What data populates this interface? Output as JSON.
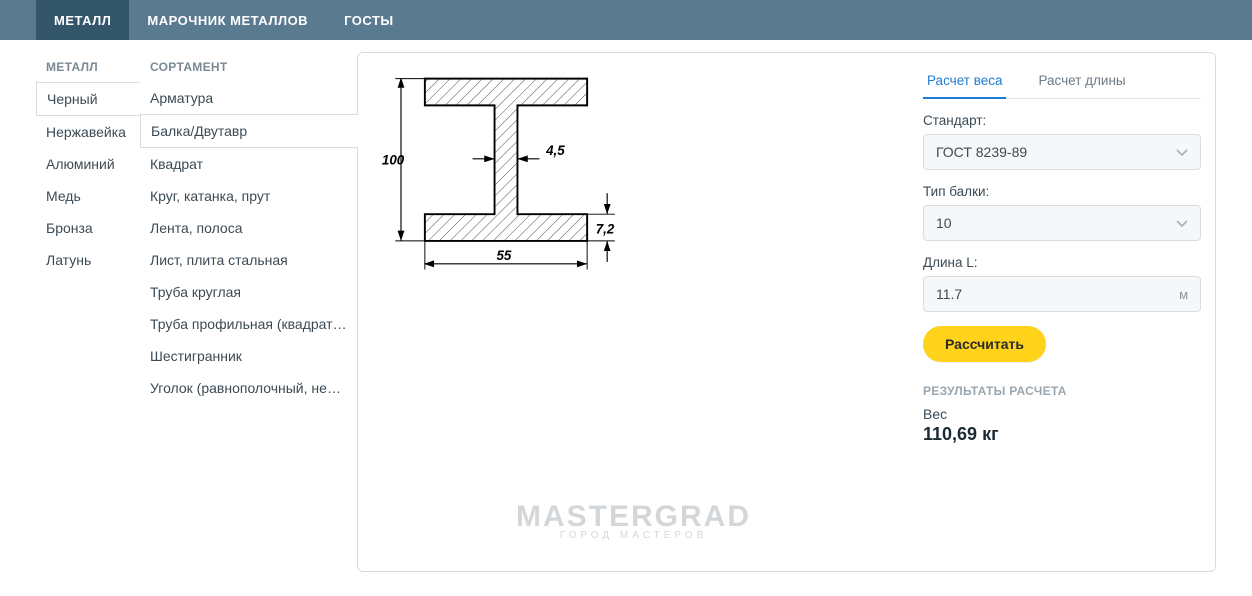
{
  "topnav": {
    "items": [
      {
        "label": "МЕТАЛЛ",
        "active": true
      },
      {
        "label": "МАРОЧНИК МЕТАЛЛОВ",
        "active": false
      },
      {
        "label": "ГОСТЫ",
        "active": false
      }
    ]
  },
  "metal": {
    "header": "МЕТАЛЛ",
    "items": [
      {
        "label": "Черный",
        "active": true
      },
      {
        "label": "Нержавейка"
      },
      {
        "label": "Алюминий"
      },
      {
        "label": "Медь"
      },
      {
        "label": "Бронза"
      },
      {
        "label": "Латунь"
      }
    ]
  },
  "sort": {
    "header": "СОРТАМЕНТ",
    "items": [
      {
        "label": "Арматура"
      },
      {
        "label": "Балка/Двутавр",
        "active": true
      },
      {
        "label": "Квадрат"
      },
      {
        "label": "Круг, катанка, прут"
      },
      {
        "label": "Лента, полоса"
      },
      {
        "label": "Лист, плита стальная"
      },
      {
        "label": "Труба круглая"
      },
      {
        "label": "Труба профильная (квадратная /…"
      },
      {
        "label": "Шестигранник"
      },
      {
        "label": "Уголок (равнополочный, неравн…"
      }
    ]
  },
  "diagram": {
    "height": "100",
    "width": "55",
    "web": "4,5",
    "flange": "7,2"
  },
  "watermark": {
    "title": "MASTERGRAD",
    "subtitle": "ГОРОД МАСТЕРОВ"
  },
  "form": {
    "tabs": [
      {
        "label": "Расчет веса",
        "active": true
      },
      {
        "label": "Расчет длины",
        "active": false
      }
    ],
    "standard_label": "Стандарт:",
    "standard_value": "ГОСТ 8239-89",
    "type_label": "Тип балки:",
    "type_value": "10",
    "length_label": "Длина L:",
    "length_value": "11.7",
    "length_unit": "м",
    "calc_label": "Рассчитать",
    "results_header": "РЕЗУЛЬТАТЫ РАСЧЕТА",
    "result_label": "Вес",
    "result_value": "110,69 кг"
  }
}
